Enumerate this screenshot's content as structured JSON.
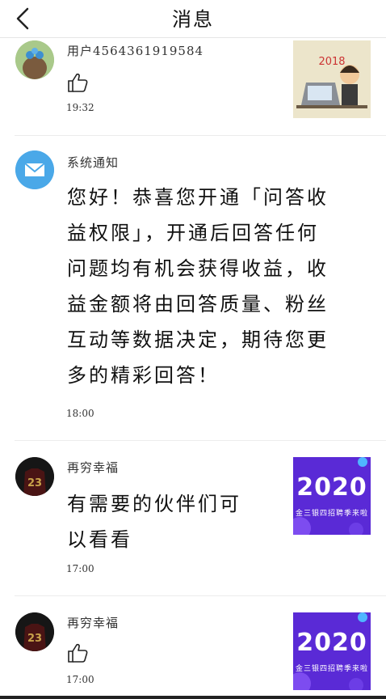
{
  "header": {
    "title": "消息"
  },
  "messages": [
    {
      "name": "用户4564361919584",
      "time": "19:32"
    },
    {
      "name": "系统通知",
      "lines": [
        "您好！恭喜您开通「问答收",
        "益权限」，开通后回答任何",
        "问题均有机会获得收益，收",
        "益金额将由回答质量、粉丝",
        "互动等数据决定，期待您更",
        "多的精彩回答！"
      ],
      "time": "18:00"
    },
    {
      "name": "再穷幸福",
      "lines": [
        "有需要的伙伴们可",
        "以看看"
      ],
      "time": "17:00"
    },
    {
      "name": "再穷幸福",
      "time": "17:00"
    }
  ],
  "promo": {
    "year": "2020",
    "subtitle": "金三银四招聘季来啦"
  },
  "icons": {
    "back": "back-arrow-icon",
    "like": "thumbs-up-icon",
    "mail": "mail-envelope-icon"
  },
  "colors": {
    "mail_avatar": "#4aa8e8",
    "promo_bg": "#5a2ad6"
  }
}
